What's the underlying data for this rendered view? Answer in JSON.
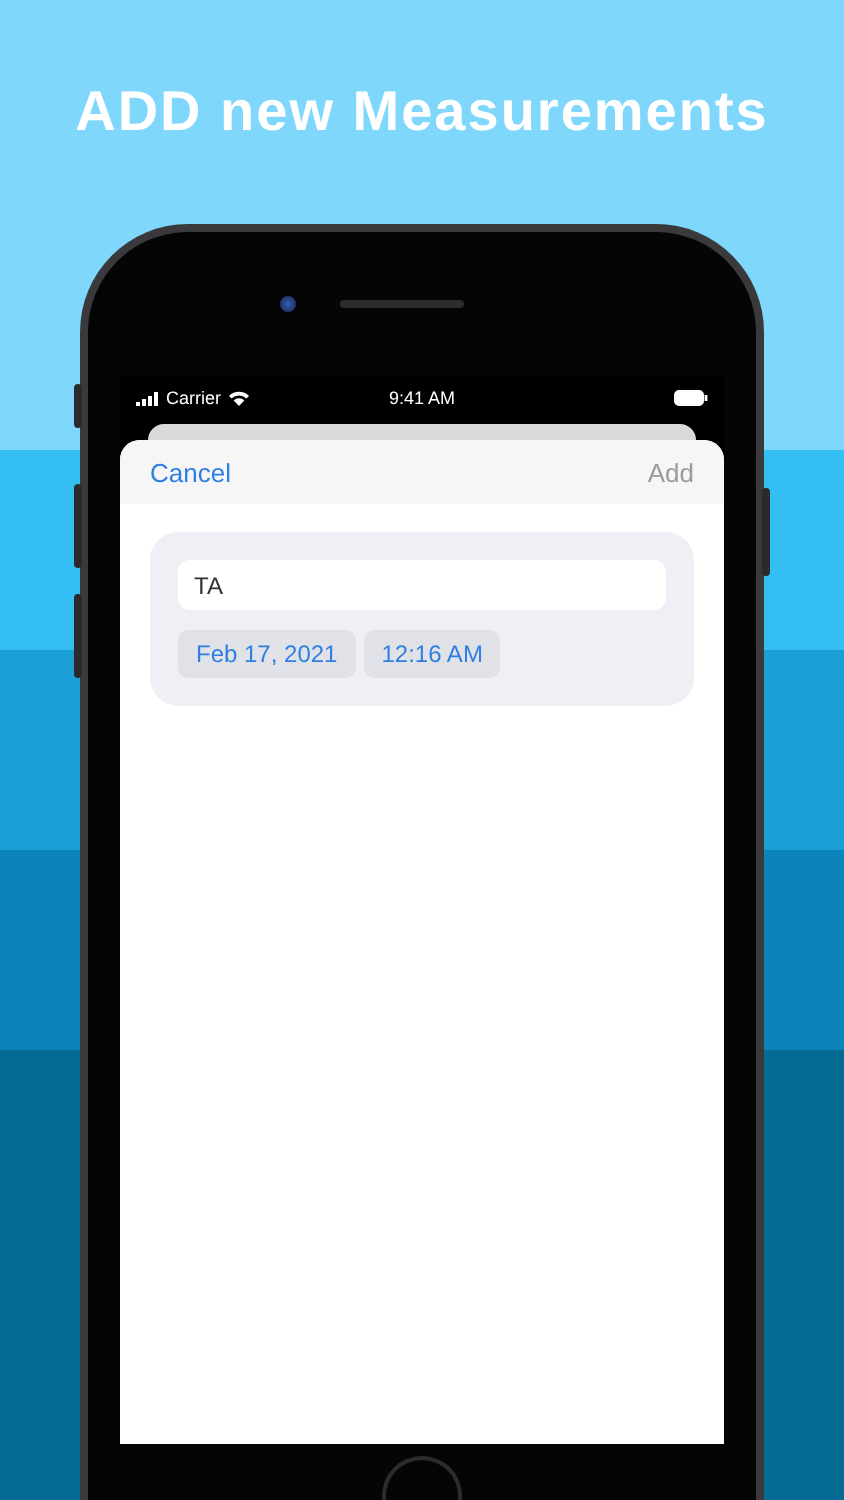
{
  "headline": "ADD new Measurements",
  "status_bar": {
    "carrier": "Carrier",
    "time": "9:41 AM"
  },
  "nav_bar": {
    "cancel": {
      "label": "Cancel",
      "disabled": false
    },
    "add": {
      "label": "Add",
      "disabled": true
    }
  },
  "form": {
    "name": {
      "value": "TA"
    },
    "date": "Feb 17, 2021",
    "time": "12:16 AM"
  }
}
